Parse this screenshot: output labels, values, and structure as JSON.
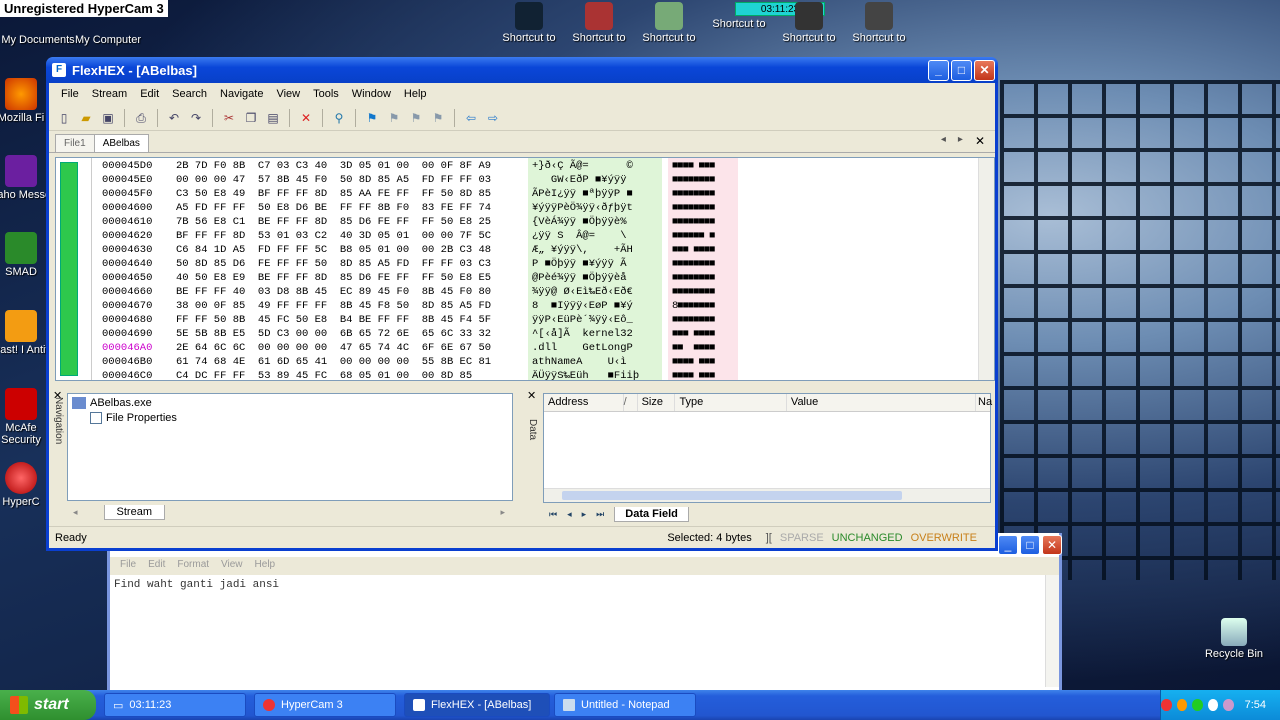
{
  "overlay": {
    "hypercam": "Unregistered HyperCam 3",
    "recording_time": "03:11:23"
  },
  "desktop": {
    "top_icons": [
      "My Documents",
      "My Computer"
    ],
    "left_icons": [
      "Mozilla Fi",
      "Yaho Messe",
      "SMAD",
      "avast! I Antivi",
      "McAfe Security",
      "HyperC"
    ],
    "shortcuts": [
      "Shortcut to",
      "Shortcut to",
      "Shortcut to",
      "Shortcut to",
      "Shortcut to",
      "Shortcut to"
    ],
    "recycle": "Recycle Bin"
  },
  "flexhex": {
    "title": "FlexHEX - [ABelbas]",
    "menu": [
      "File",
      "Stream",
      "Edit",
      "Search",
      "Navigate",
      "View",
      "Tools",
      "Window",
      "Help"
    ],
    "tabs": [
      "File1",
      "ABelbas"
    ],
    "rows": [
      {
        "addr": "000045D0",
        "hex": "2B 7D F0 8B  C7 03 C3 40  3D 05 01 00  00 0F 8F A9",
        "ascii": "+}ð‹Ç Ã@=      ©",
        "blk": "■■■■ ■■■"
      },
      {
        "addr": "000045E0",
        "hex": "00 00 00 47  57 8B 45 F0  50 8D 85 A5  FD FF FF 03",
        "ascii": "   GW‹EðP ■¥ýÿÿ",
        "blk": "■■■■■■■■"
      },
      {
        "addr": "000045F0",
        "hex": "C3 50 E8 49  BF FF FF 8D  85 AA FE FF  FF 50 8D 85",
        "ascii": "ÃPèI¿ÿÿ ■ªþÿÿP ■",
        "blk": "■■■■■■■■"
      },
      {
        "addr": "00004600",
        "hex": "A5 FD FF FF  50 E8 D6 BE  FF FF 8B F0  83 FE FF 74",
        "ascii": "¥ýÿÿPèÖ¾ÿÿ‹ðƒþÿt",
        "blk": "■■■■■■■■"
      },
      {
        "addr": "00004610",
        "hex": "7B 56 E8 C1  BE FF FF 8D  85 D6 FE FF  FF 50 E8 25",
        "ascii": "{VèÁ¾ÿÿ ■Öþÿÿè%",
        "blk": "■■■■■■■■"
      },
      {
        "addr": "00004620",
        "hex": "BF FF FF 8D  53 01 03 C2  40 3D 05 01  00 00 7F 5C",
        "ascii": "¿ÿÿ S  Â@=    \\",
        "blk": "■■■■■■ ■"
      },
      {
        "addr": "00004630",
        "hex": "C6 84 1D A5  FD FF FF 5C  B8 05 01 00  00 2B C3 48",
        "ascii": "Æ„ ¥ýÿÿ\\,    +ÃH",
        "blk": "■■■ ■■■■"
      },
      {
        "addr": "00004640",
        "hex": "50 8D 85 D6  FE FF FF 50  8D 85 A5 FD  FF FF 03 C3",
        "ascii": "P ■Öþÿÿ ■¥ýÿÿ Ã",
        "blk": "■■■■■■■■"
      },
      {
        "addr": "00004650",
        "hex": "40 50 E8 E9  BE FF FF 8D  85 D6 FE FF  FF 50 E8 E5",
        "ascii": "@Pèé¾ÿÿ ■Öþÿÿèå",
        "blk": "■■■■■■■■"
      },
      {
        "addr": "00004660",
        "hex": "BE FF FF 40  03 D8 8B 45  EC 89 45 F0  8B 45 F0 80",
        "ascii": "¾ÿÿ@ Ø‹Eì‰Eð‹Eð€",
        "blk": "■■■■■■■■"
      },
      {
        "addr": "00004670",
        "hex": "38 00 0F 85  49 FF FF FF  8B 45 F8 50  8D 85 A5 FD",
        "ascii": "8  ■Iÿÿÿ‹EøP ■¥ý",
        "blk": "8■■■■■■■"
      },
      {
        "addr": "00004680",
        "hex": "FF FF 50 8B  45 FC 50 E8  B4 BE FF FF  8B 45 F4 5F",
        "ascii": "ÿÿP‹EüPè´¾ÿÿ‹Eô_",
        "blk": "■■■■■■■■"
      },
      {
        "addr": "00004690",
        "hex": "5E 5B 8B E5  5D C3 00 00  6B 65 72 6E  65 6C 33 32",
        "ascii": "^[‹å]Ã  kernel32",
        "blk": "■■■ ■■■■"
      },
      {
        "addr": "000046A0",
        "hex": "2E 64 6C 6C  00 00 00 00  47 65 74 4C  6F 6E 67 50",
        "ascii": ".dll    GetLongP",
        "blk": "■■  ■■■■"
      },
      {
        "addr": "000046B0",
        "hex": "61 74 68 4E  61 6D 65 41  00 00 00 00  55 8B EC 81",
        "ascii": "athNameA    U‹ì ",
        "blk": "■■■■ ■■■"
      },
      {
        "addr": "000046C0",
        "hex": "C4 DC FF FF  53 89 45 FC  68 05 01 00  00 8D 85",
        "ascii": "ÄÜÿÿS‰Eüh   ■Fiiþ",
        "blk": "■■■■ ■■■"
      }
    ],
    "nav_pane": {
      "root": "ABelbas.exe",
      "child": "File Properties",
      "tab": "Stream",
      "side_label": "Navigation"
    },
    "data_pane": {
      "side_label": "Data",
      "columns": [
        "Address",
        "/",
        "Size",
        "Type",
        "Value",
        "Na"
      ],
      "tab": "Data Field"
    },
    "status": {
      "left": "Ready",
      "selected": "Selected: 4 bytes",
      "sep": "][",
      "sparse": "SPARSE",
      "unchanged": "UNCHANGED",
      "overwrite": "OVERWRITE"
    }
  },
  "notepad": {
    "menu": [
      "File",
      "Edit",
      "Format",
      "View",
      "Help"
    ],
    "text": "Find waht ganti jadi ansi"
  },
  "taskbar": {
    "start": "start",
    "tasks": [
      "03:11:23",
      "HyperCam 3",
      "FlexHEX - [ABelbas]",
      "Untitled - Notepad"
    ],
    "clock": "7:54"
  }
}
